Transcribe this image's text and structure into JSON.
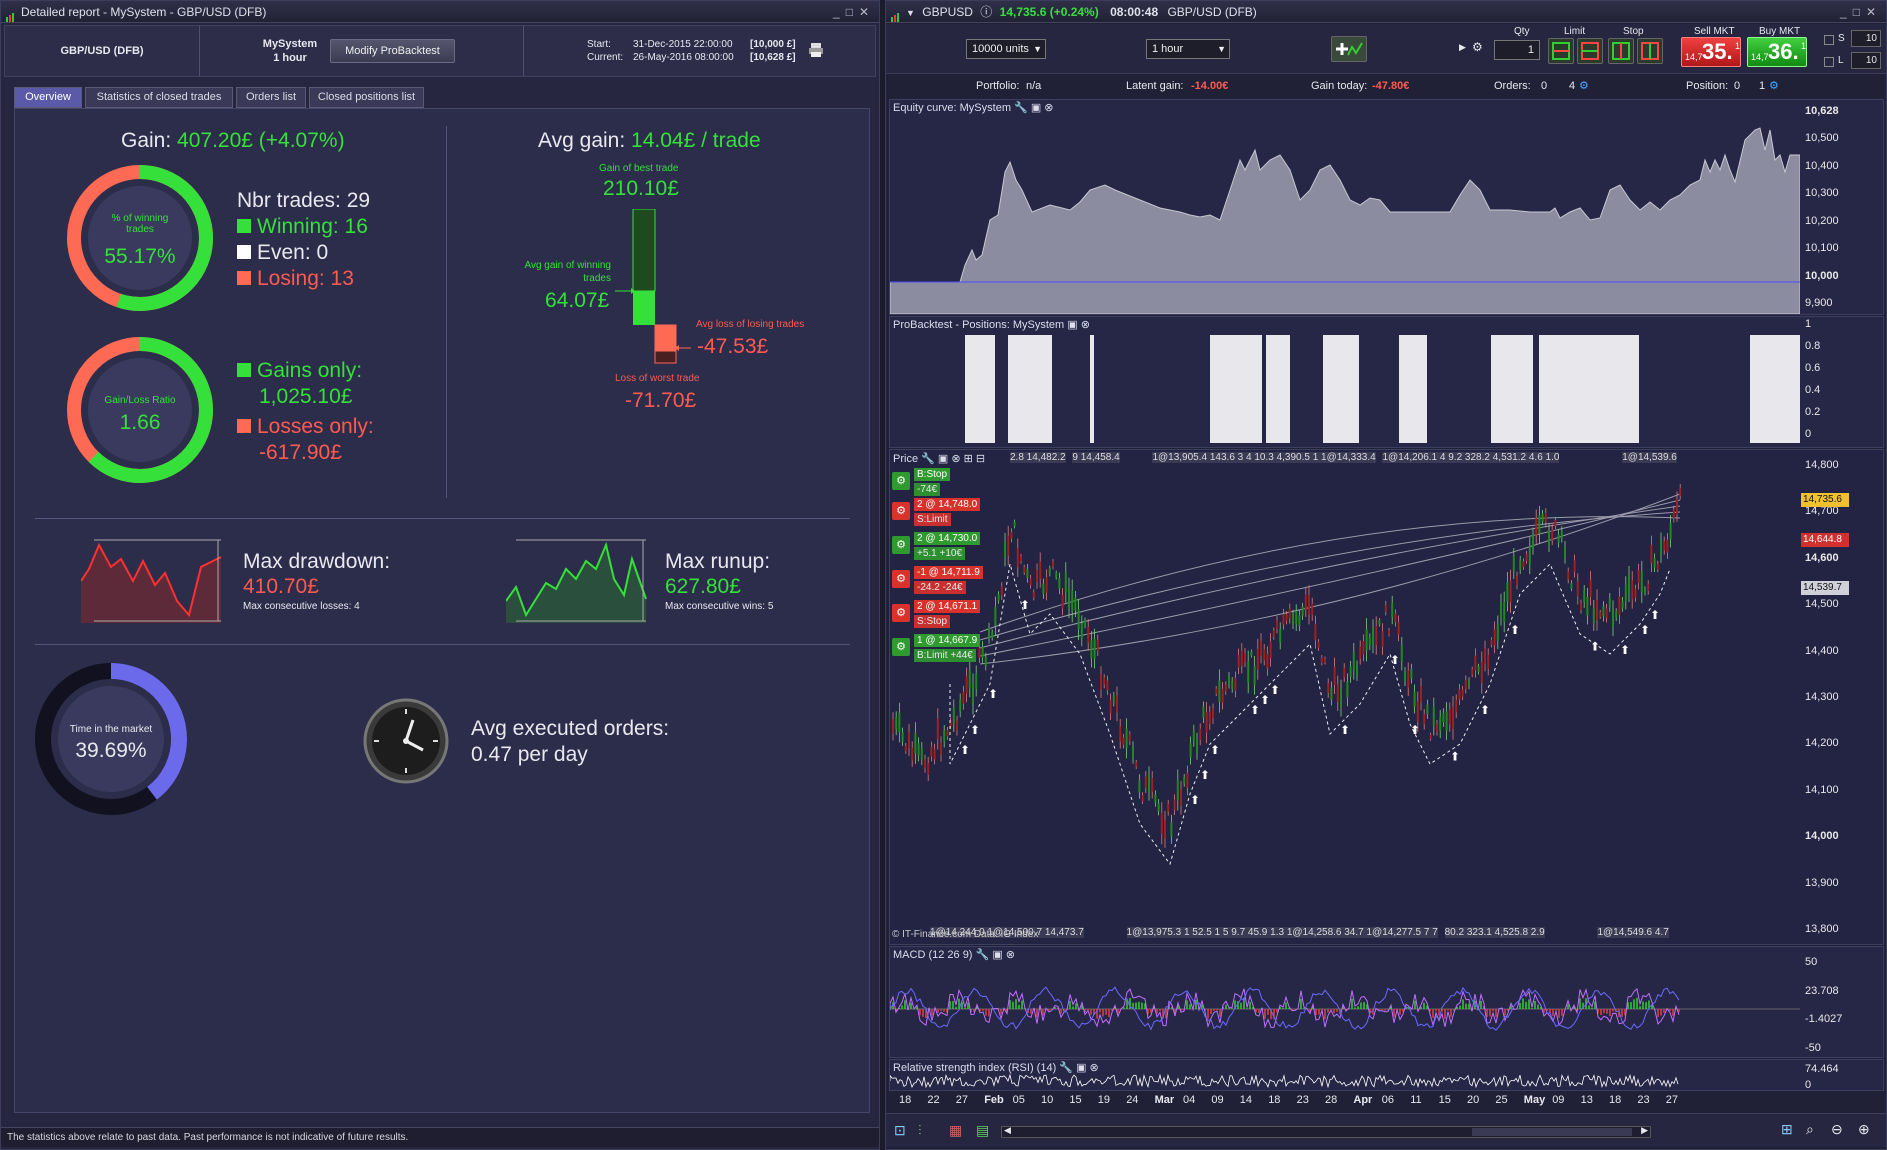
{
  "left": {
    "title": "Detailed report - MySystem - GBP/USD (DFB)",
    "instrument": "GBP/USD (DFB)",
    "system_name": "MySystem",
    "timeframe": "1 hour",
    "modify_label": "Modify ProBacktest",
    "start_label": "Start:",
    "start_value": "31-Dec-2015 22:00:00",
    "start_capital": "[10,000 £]",
    "current_label": "Current:",
    "current_value": "26-May-2016 08:00:00",
    "current_capital": "[10,628 £]",
    "tabs": [
      "Overview",
      "Statistics of closed trades",
      "Orders list",
      "Closed positions list"
    ],
    "gain_label": "Gain:",
    "gain_value": "407.20£ (+4.07%)",
    "win_pct_caption": "% of winning trades",
    "win_pct_value": "55.17%",
    "win_pct": 55.17,
    "nbr_trades": "Nbr trades: 29",
    "winning": "Winning: 16",
    "even": "Even: 0",
    "losing": "Losing: 13",
    "ratio_caption": "Gain/Loss Ratio",
    "ratio_value": "1.66",
    "gains_only_label": "Gains only:",
    "gains_only_value": "1,025.10£",
    "losses_only_label": "Losses only:",
    "losses_only_value": "-617.90£",
    "avg_gain_label": "Avg gain:",
    "avg_gain_value": "14.04£ / trade",
    "best_trade_caption": "Gain of best trade",
    "best_trade_value": "210.10£",
    "avg_win_caption": "Avg gain of winning trades",
    "avg_win_value": "64.07£",
    "avg_loss_caption": "Avg loss of losing trades",
    "avg_loss_value": "-47.53£",
    "worst_caption": "Loss of worst trade",
    "worst_value": "-71.70£",
    "max_dd_label": "Max drawdown:",
    "max_dd_value": "410.70£",
    "max_dd_sub": "Max consecutive losses: 4",
    "max_ru_label": "Max runup:",
    "max_ru_value": "627.80£",
    "max_ru_sub": "Max consecutive wins: 5",
    "market_caption": "Time in the market",
    "market_value": "39.69%",
    "market_pct": 39.69,
    "avg_orders_label": "Avg executed orders:",
    "avg_orders_value": "0.47 per day",
    "disclaimer": "The statistics above relate to past data. Past performance is not indicative of future results."
  },
  "right": {
    "symbol": "GBPUSD",
    "price_change": "14,735.6 (+0.24%)",
    "time": "08:00:48",
    "instrument": "GBP/USD (DFB)",
    "units_select": "10000 units",
    "tf_select": "1 hour",
    "qty_label": "Qty",
    "qty_value": "1",
    "limit_label": "Limit",
    "stop_label": "Stop",
    "sell_label": "Sell MKT",
    "sell_small": "14,7",
    "sell_big": "35.",
    "sell_sup": "1",
    "buy_label": "Buy MKT",
    "buy_small": "14,7",
    "buy_big": "36.",
    "buy_sup": "1",
    "s_val": "10",
    "l_val": "10",
    "status": {
      "portfolio_label": "Portfolio:",
      "portfolio_value": "n/a",
      "latent_label": "Latent gain:",
      "latent_value": "-14.00€",
      "today_label": "Gain today:",
      "today_value": "-47.80€",
      "orders_label": "Orders:",
      "orders_a": "0",
      "orders_b": "4",
      "position_label": "Position:",
      "position_a": "0",
      "position_b": "1"
    },
    "equity_title": "Equity curve: MySystem",
    "equity_axis": [
      "10,628",
      "10,500",
      "10,400",
      "10,300",
      "10,200",
      "10,100",
      "10,000",
      "9,900"
    ],
    "positions_title": "ProBacktest - Positions: MySystem",
    "positions_axis": [
      "1",
      "0.8",
      "0.6",
      "0.4",
      "0.2",
      "0"
    ],
    "price_title": "Price",
    "price_axis": [
      "14,800",
      "14,700",
      "14,600",
      "14,500",
      "14,400",
      "14,300",
      "14,200",
      "14,100",
      "14,000",
      "13,900",
      "13,800"
    ],
    "price_tags": [
      "14,735.6",
      "14,644.8",
      "14,539.7"
    ],
    "top_labels": [
      "2.8 14,482.2",
      "9 14,458.4",
      "1@13,905.4 143.6 3 4 10.3 4,390.5 1 1@14,333.4",
      "1@14,206.1 4 9.2 328.2 4,531.2 4.6 1.0",
      "1@14,539.6"
    ],
    "bottom_labels": [
      "1@14,244.0 1@14,500.7 14,473.7",
      "1@13,975.3 1 52.5 1 5 9.7 45.9 1.3 1@14,258.6 34.7 1@14,277.5 7 7",
      "80.2 323.1 4,525.8 2.9",
      "1@14,549.6 4.7"
    ],
    "copyright": "© IT-Finance.com Data: IG Index",
    "orders": [
      {
        "head": "B:Stop",
        "val": "-74€",
        "color": "#2f9b2f"
      },
      {
        "head": "2 @ 14,748.0",
        "val": "S:Limit",
        "color": "#d9322c"
      },
      {
        "head": "2 @ 14,730.0",
        "val": "+5.1  +10€",
        "color": "#2f9b2f"
      },
      {
        "head": "-1 @ 14,711.9",
        "val": "-24.2  -24€",
        "color": "#d9322c"
      },
      {
        "head": "2 @ 14,671.1",
        "val": "S:Stop",
        "color": "#d9322c"
      },
      {
        "head": "1 @ 14,667.9",
        "val": "B:Limit  +44€",
        "color": "#2f9b2f"
      }
    ],
    "macd_title": "MACD (12 26 9)",
    "macd_axis": [
      "50",
      "23.708",
      "-1.4027",
      "-50"
    ],
    "rsi_title": "Relative strength index (RSI) (14)",
    "rsi_axis": [
      "74.464",
      "0"
    ],
    "x_labels": [
      "18",
      "22",
      "27",
      "Feb",
      "05",
      "10",
      "15",
      "19",
      "24",
      "Mar",
      "04",
      "09",
      "14",
      "18",
      "23",
      "28",
      "Apr",
      "06",
      "11",
      "15",
      "20",
      "25",
      "May",
      "09",
      "13",
      "18",
      "23",
      "27"
    ]
  }
}
